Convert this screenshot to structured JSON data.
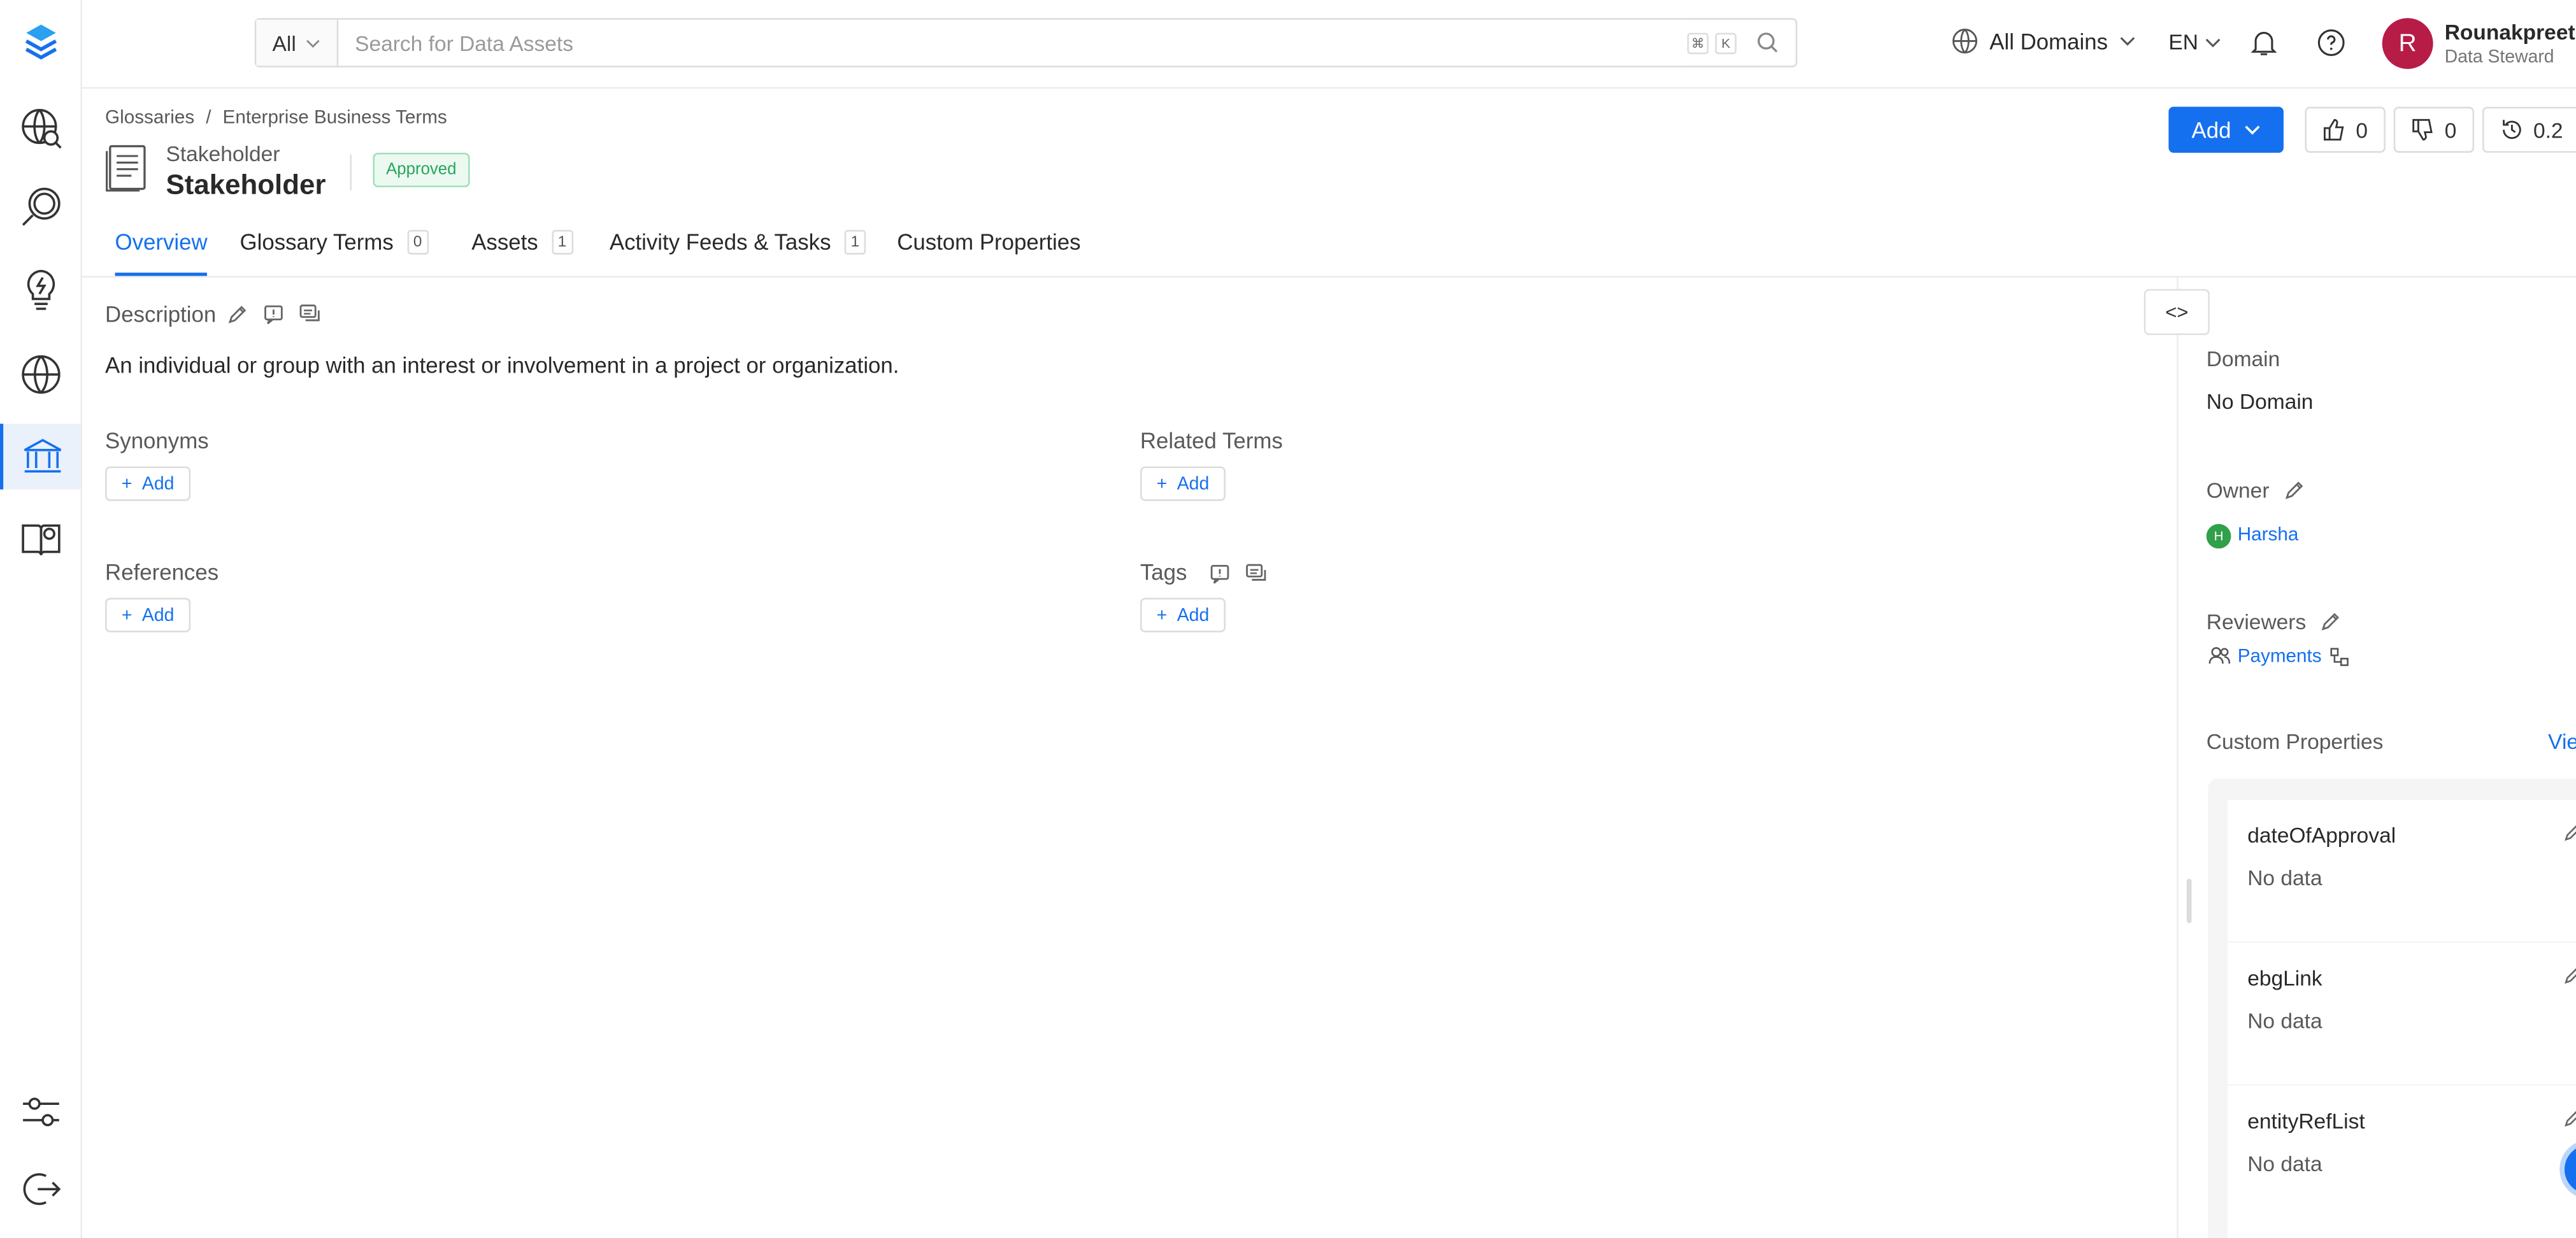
{
  "topbar": {
    "search_category": "All",
    "search_placeholder": "Search for Data Assets",
    "shortcut_cmd": "⌘",
    "shortcut_key": "K",
    "domains_label": "All Domains",
    "language": "EN",
    "user": {
      "initial": "R",
      "name": "Rounakpreet.",
      "role": "Data Steward"
    }
  },
  "sidebar": {
    "items": [
      {
        "icon": "explore-icon"
      },
      {
        "icon": "data-quality-icon"
      },
      {
        "icon": "insights-icon"
      },
      {
        "icon": "domains-icon"
      },
      {
        "icon": "governance-icon",
        "active": true
      },
      {
        "icon": "knowledge-center-icon"
      }
    ],
    "bottom": [
      {
        "icon": "settings-icon"
      },
      {
        "icon": "logout-icon"
      }
    ]
  },
  "header": {
    "breadcrumb": [
      "Glossaries",
      "Enterprise Business Terms"
    ],
    "breadcrumb_sep": "/",
    "display_label": "Stakeholder",
    "display_name": "Stakeholder",
    "status": "Approved",
    "add_label": "Add",
    "upvotes": "0",
    "downvotes": "0",
    "version": "0.2"
  },
  "tabs": [
    {
      "label": "Overview",
      "active": true
    },
    {
      "label": "Glossary Terms",
      "count": "0"
    },
    {
      "label": "Assets",
      "count": "1"
    },
    {
      "label": "Activity Feeds & Tasks",
      "count": "1"
    },
    {
      "label": "Custom Properties"
    }
  ],
  "main": {
    "description_label": "Description",
    "description_text": "An individual or group with an interest or involvement in a project or organization.",
    "synonyms_label": "Synonyms",
    "related_terms_label": "Related Terms",
    "references_label": "References",
    "tags_label": "Tags",
    "add_label": "Add"
  },
  "right_panel": {
    "collapse_label": "<>",
    "domain_label": "Domain",
    "domain_value": "No Domain",
    "owner_label": "Owner",
    "owner_initial": "H",
    "owner_name": "Harsha",
    "reviewers_label": "Reviewers",
    "reviewer_name": "Payments",
    "custom_properties_label": "Custom Properties",
    "view_all_label": "Vie",
    "custom_properties": [
      {
        "name": "dateOfApproval",
        "value": "No data"
      },
      {
        "name": "ebgLink",
        "value": "No data"
      },
      {
        "name": "entityRefList",
        "value": "No data"
      }
    ]
  },
  "colors": {
    "accent": "#1570ef",
    "approved_text": "#26a55b",
    "approved_bg": "#ecf9f1",
    "avatar_user": "#b71c47",
    "avatar_owner": "#30a04a"
  }
}
